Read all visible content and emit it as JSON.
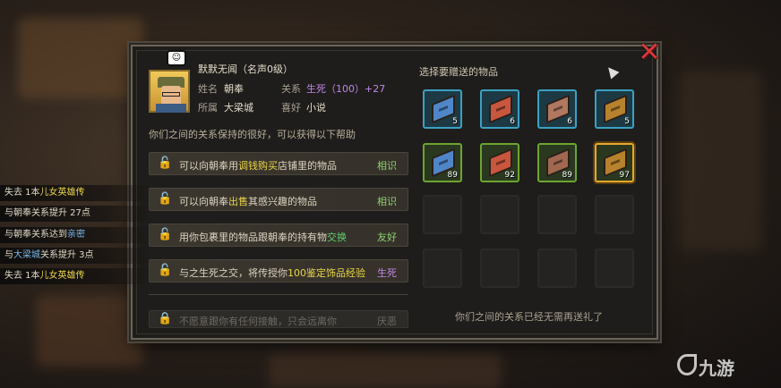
{
  "profile": {
    "name": "默默无闻（名声0级）",
    "name_label": "姓名",
    "name_value": "朝奉",
    "relation_label": "关系",
    "relation_value": "生死（100）+27",
    "faction_label": "所属",
    "faction_value": "大梁城",
    "hobby_label": "喜好",
    "hobby_value": "小说",
    "emote": "☺"
  },
  "intro": "你们之间的关系保持的很好，可以获得以下帮助",
  "perks": [
    {
      "pre": "可以向朝奉用",
      "mid": "调钱",
      "mid2": "购买",
      "post": "店铺里的物品",
      "tier": "相识"
    },
    {
      "pre": "可以向朝奉",
      "mid": "出售",
      "post": "其感兴趣的物品",
      "tier": "相识"
    },
    {
      "pre": "用你包裹里的物品跟朝奉的持有物",
      "mid": "交换",
      "post": "",
      "tier": "友好"
    },
    {
      "pre": "与之生死之交，将传授你",
      "mid": "100",
      "post": "鉴定饰品经验",
      "tier": "生死"
    },
    {
      "pre": "不愿意跟你有任何接触，只会远离你",
      "mid": "",
      "post": "",
      "tier": "厌恶"
    }
  ],
  "gift": {
    "title": "选择要赠送的物品",
    "footer": "你们之间的关系已经无需再送礼了",
    "items": [
      {
        "count": "5",
        "frame": "blue",
        "color": "#4f86c8"
      },
      {
        "count": "6",
        "frame": "blue",
        "color": "#c8573d"
      },
      {
        "count": "6",
        "frame": "blue",
        "color": "#b07860"
      },
      {
        "count": "5",
        "frame": "blue",
        "color": "#b7812e"
      },
      {
        "count": "89",
        "frame": "green",
        "color": "#4f86c8"
      },
      {
        "count": "92",
        "frame": "green",
        "color": "#c8573d"
      },
      {
        "count": "89",
        "frame": "green",
        "color": "#a06850"
      },
      {
        "count": "97",
        "frame": "green",
        "color": "#b7812e"
      }
    ]
  },
  "log": [
    {
      "a": "失去 1本",
      "b": "儿女英雄传",
      "c": ""
    },
    {
      "a": "与朝奉关系提升 27点",
      "b": "",
      "c": ""
    },
    {
      "a": "与朝奉关系达到",
      "b": "",
      "c": "亲密"
    },
    {
      "a": "与",
      "b": "大梁城",
      "c": "关系提升 3点"
    },
    {
      "a": "失去 1本",
      "b": "儿女英雄传",
      "c": ""
    }
  ],
  "watermark": "九游",
  "colors": {
    "accent_green": "#3fd064",
    "close_red": "#d8383b",
    "select_gold": "#e7a82a"
  }
}
